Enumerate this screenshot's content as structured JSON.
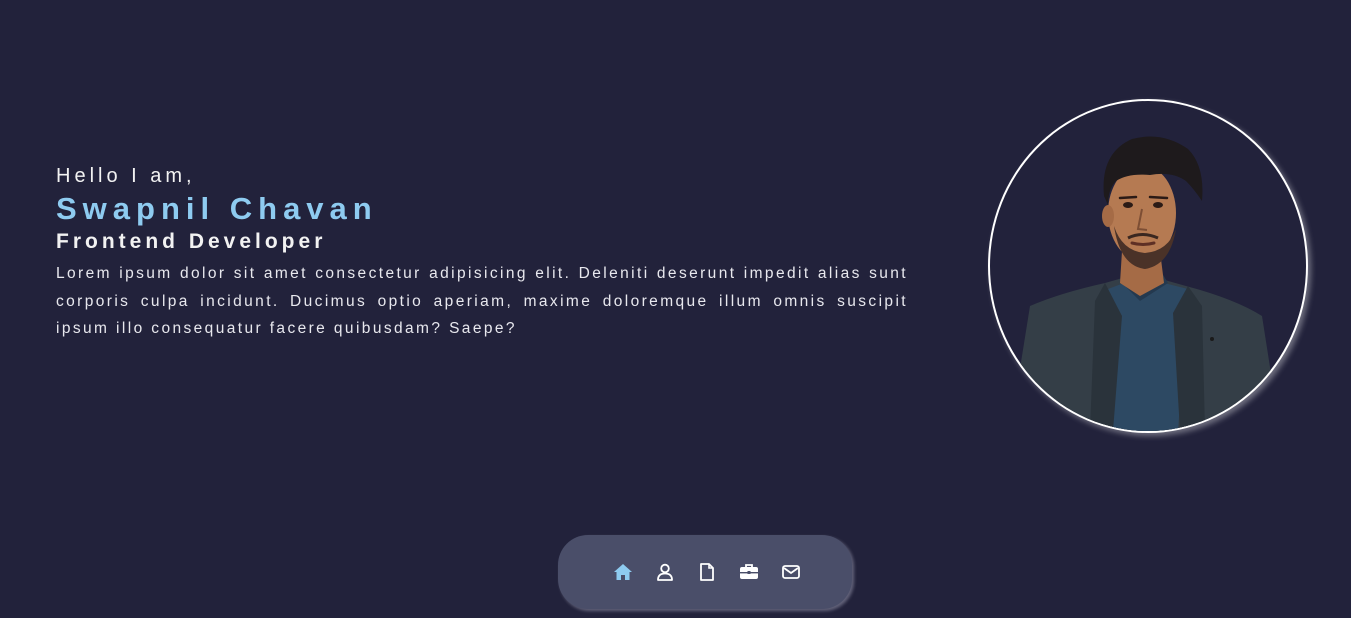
{
  "hero": {
    "greeting": "Hello I am,",
    "name": "Swapnil Chavan",
    "role": "Frontend Developer",
    "bio": "Lorem ipsum dolor sit amet consectetur adipisicing elit. Deleniti deserunt impedit alias sunt corporis culpa incidunt. Ducimus optio aperiam, maxime doloremque illum omnis suscipit ipsum illo consequatur facere quibusdam? Saepe?"
  },
  "profile": {
    "photo_description": "profile-photo"
  },
  "dock": {
    "items": [
      {
        "icon": "home-icon",
        "active": true
      },
      {
        "icon": "user-icon",
        "active": false
      },
      {
        "icon": "document-icon",
        "active": false
      },
      {
        "icon": "briefcase-icon",
        "active": false
      },
      {
        "icon": "mail-icon",
        "active": false
      }
    ]
  },
  "colors": {
    "background": "#22223b",
    "accent": "#8ecbf0",
    "dock": "#4a4e69",
    "text": "#f2f2f2"
  }
}
